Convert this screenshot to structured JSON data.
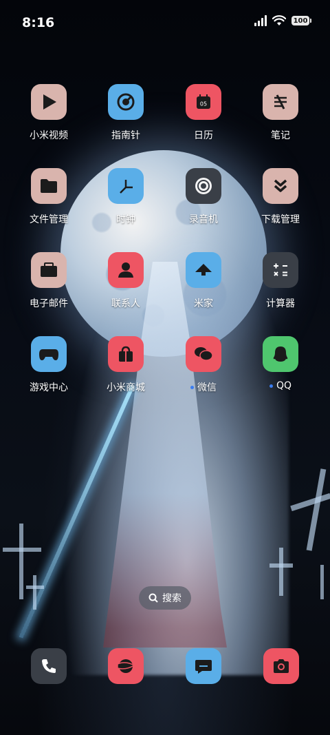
{
  "status_bar": {
    "time": "8:16",
    "battery": "100"
  },
  "colors": {
    "pink": "#d9b4ad",
    "blue": "#5aaee8",
    "red": "#ee5563",
    "gray": "#3a3f47",
    "green": "#4fc66e"
  },
  "apps": [
    {
      "label": "小米视频",
      "icon": "play-icon",
      "color": "#d9b4ad"
    },
    {
      "label": "指南针",
      "icon": "compass-icon",
      "color": "#5aaee8"
    },
    {
      "label": "日历",
      "icon": "calendar-icon",
      "color": "#ee5563",
      "icon_text": "05"
    },
    {
      "label": "笔记",
      "icon": "notes-icon",
      "color": "#d9b4ad"
    },
    {
      "label": "文件管理",
      "icon": "folder-icon",
      "color": "#d9b4ad"
    },
    {
      "label": "时钟",
      "icon": "clock-icon",
      "color": "#5aaee8"
    },
    {
      "label": "录音机",
      "icon": "recorder-icon",
      "color": "#3a3f47"
    },
    {
      "label": "下载管理",
      "icon": "download-icon",
      "color": "#d9b4ad"
    },
    {
      "label": "电子邮件",
      "icon": "mail-icon",
      "color": "#d9b4ad"
    },
    {
      "label": "联系人",
      "icon": "contacts-icon",
      "color": "#ee5563"
    },
    {
      "label": "米家",
      "icon": "home-icon",
      "color": "#5aaee8"
    },
    {
      "label": "计算器",
      "icon": "calculator-icon",
      "color": "#3a3f47"
    },
    {
      "label": "游戏中心",
      "icon": "gamepad-icon",
      "color": "#5aaee8"
    },
    {
      "label": "小米商城",
      "icon": "shop-icon",
      "color": "#ee5563"
    },
    {
      "label": "微信",
      "icon": "wechat-icon",
      "color": "#ee5563",
      "new_dot": true
    },
    {
      "label": "QQ",
      "icon": "qq-icon",
      "color": "#4fc66e",
      "new_dot": true
    }
  ],
  "search": {
    "label": "搜索"
  },
  "dock": [
    {
      "name": "phone",
      "icon": "phone-icon",
      "color": "#3a3f47"
    },
    {
      "name": "browser",
      "icon": "browser-icon",
      "color": "#ee5563"
    },
    {
      "name": "messages",
      "icon": "message-icon",
      "color": "#5aaee8"
    },
    {
      "name": "camera",
      "icon": "camera-icon",
      "color": "#ee5563"
    }
  ]
}
